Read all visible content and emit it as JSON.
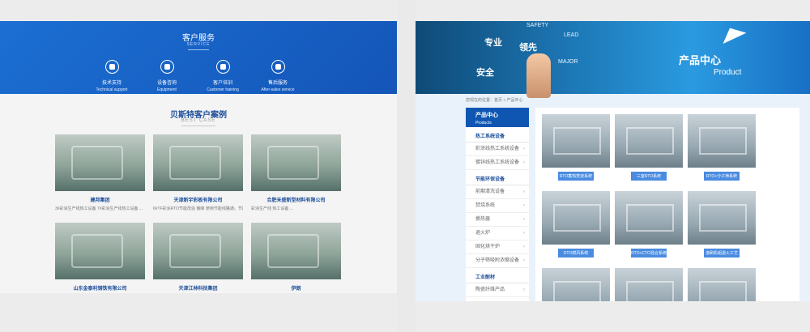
{
  "left": {
    "service": {
      "title": "客户服务",
      "subtitle": "SERVICE",
      "items": [
        {
          "name": "技术支持",
          "en": "Technical support",
          "icon": "support-icon"
        },
        {
          "name": "设备咨询",
          "en": "Equipment",
          "icon": "equipment-icon"
        },
        {
          "name": "客户培训",
          "en": "Customer training",
          "icon": "training-icon"
        },
        {
          "name": "售后服务",
          "en": "After-sales service",
          "icon": "aftersales-icon"
        }
      ]
    },
    "cases": {
      "title": "贝斯特客户案例",
      "subtitle": "BEST CASE",
      "items": [
        {
          "name": "建邦集团",
          "desc": "3#彩涂生产线热工设备 7#彩涂生产线热工设备 ..."
        },
        {
          "name": "天津新宇彩板有限公司",
          "desc": "6#TF彩涂RTO节能改造 傲峰 使用节能线路通。节能改..."
        },
        {
          "name": "合肥禾盛新型材料有限公司",
          "desc": "彩涂生产线 热工设备 ..."
        },
        {
          "name": "山东金泰利钢铁有限公司",
          "desc": ""
        },
        {
          "name": "天津江林科技集团",
          "desc": ""
        },
        {
          "name": "伊朗",
          "desc": ""
        }
      ]
    }
  },
  "right": {
    "banner": {
      "tags": [
        "专业",
        "领先",
        "安全"
      ],
      "tags_en": [
        "SAFETY",
        "LEAD",
        "MAJOR"
      ],
      "title": "产品中心",
      "title_en": "Product"
    },
    "breadcrumb": "您现在的位置：首页 » 产品中心",
    "sidebar": {
      "title": "产品中心",
      "title_en": "Products",
      "categories": [
        {
          "label": "热工系统设备",
          "items": [
            "彩涂线热工系统设备",
            "镀锌线热工系统设备"
          ]
        },
        {
          "label": "节能环保设备",
          "items": [
            "前期清洗设备",
            "焚烧系统",
            "换热器",
            "退火炉",
            "固化烘干炉",
            "分子筛吸附浓缩设备"
          ]
        },
        {
          "label": "工业耐材",
          "items": [
            "陶瓷纤维产品"
          ]
        }
      ]
    },
    "products": [
      "RTO蓄热焚烧系统",
      "三室RTO系统",
      "RTO+分子筛系统",
      "DTO燃风系统",
      "RTO+CTO混合系统",
      "滚刷机组退火工艺"
    ]
  }
}
